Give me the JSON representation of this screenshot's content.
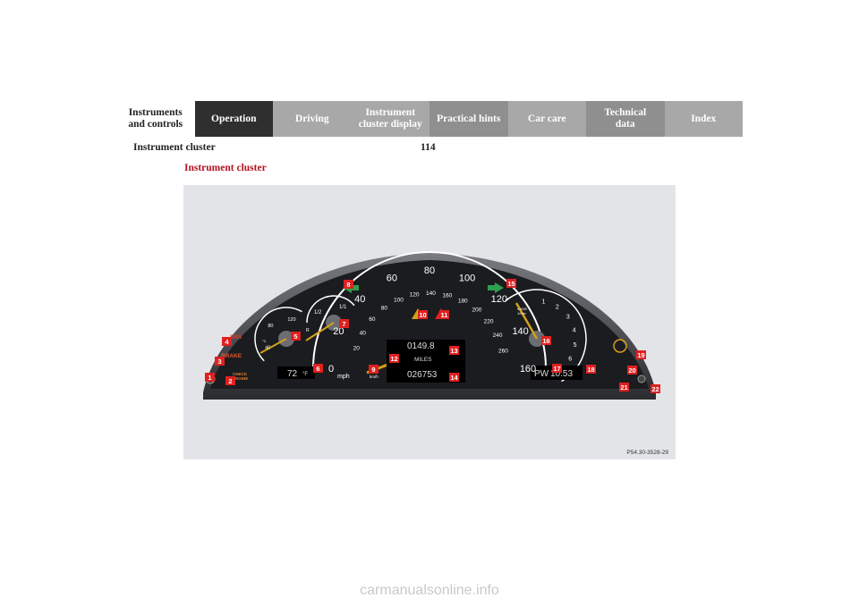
{
  "nav": {
    "tabs": [
      {
        "label": "Instruments\nand controls",
        "style": "plain"
      },
      {
        "label": "Operation",
        "style": "dark"
      },
      {
        "label": "Driving",
        "style": "light"
      },
      {
        "label": "Instrument\ncluster display",
        "style": "light"
      },
      {
        "label": "Practical hints",
        "style": "mid"
      },
      {
        "label": "Car care",
        "style": "light"
      },
      {
        "label": "Technical\ndata",
        "style": "mid"
      },
      {
        "label": "Index",
        "style": "light"
      }
    ]
  },
  "header": {
    "section": "Instrument cluster",
    "page_number": "114"
  },
  "section_title": "Instrument cluster",
  "figure": {
    "code": "P54.30-3528-29",
    "speedometer": {
      "mph_labels": [
        "0",
        "20",
        "40",
        "60",
        "80",
        "100",
        "120",
        "140",
        "160"
      ],
      "kmh_labels": [
        "20",
        "40",
        "60",
        "80",
        "100",
        "120",
        "140",
        "160",
        "180",
        "200",
        "220",
        "240",
        "260"
      ],
      "unit_mph": "mph",
      "unit_kmh": "km/h"
    },
    "tachometer": {
      "labels": [
        "1",
        "2",
        "3",
        "4",
        "5",
        "6"
      ],
      "unit": "x1000\n1/min"
    },
    "coolant_gauge": {
      "labels": [
        "120",
        "80",
        "40"
      ],
      "unit": "°C"
    },
    "fuel_gauge": {
      "labels": [
        "1/2",
        "1/1",
        "R"
      ]
    },
    "display": {
      "trip": "0149.8",
      "unit": "MILES",
      "odometer": "026753",
      "temperature": "72",
      "temp_unit": "°F",
      "gear": "PW",
      "clock": "10:53"
    },
    "lamps": {
      "srs": "SRS",
      "brake": "BRAKE",
      "check_engine": "CHECK\nENGINE"
    },
    "callouts": [
      "1",
      "2",
      "3",
      "4",
      "5",
      "6",
      "7",
      "8",
      "9",
      "10",
      "11",
      "12",
      "13",
      "14",
      "15",
      "16",
      "17",
      "18",
      "19",
      "20",
      "21",
      "22"
    ],
    "colors": {
      "callout": "#e0201f",
      "turn_signal": "#2e9e4f",
      "needle": "#d4a017",
      "dial": "#1b1c1f"
    }
  },
  "footer": {
    "watermark": "carmanualsonline.info"
  }
}
